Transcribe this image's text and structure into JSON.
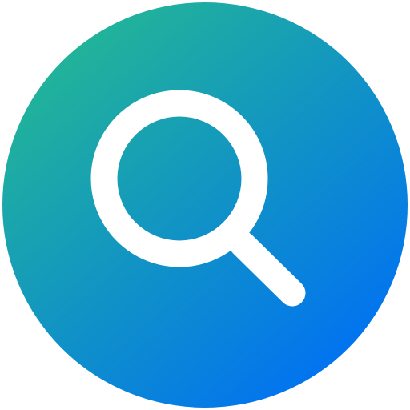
{
  "icon": {
    "name": "search-icon",
    "gradient_start": "#22B597",
    "gradient_end": "#0071F3",
    "glyph_color": "#FFFFFF"
  }
}
